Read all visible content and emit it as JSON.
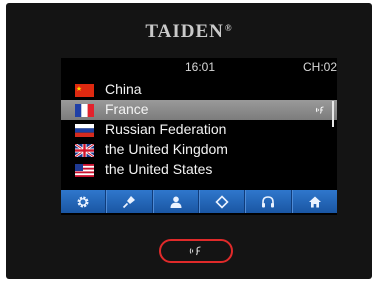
{
  "brand": {
    "name": "TAIDEN",
    "mark": "®"
  },
  "status": {
    "time": "16:01",
    "channel": "CH:02"
  },
  "languages": [
    {
      "label": "China",
      "flag": "china-flag-icon",
      "selected": false
    },
    {
      "label": "France",
      "flag": "france-flag-icon",
      "selected": true
    },
    {
      "label": "Russian Federation",
      "flag": "russia-flag-icon",
      "selected": false
    },
    {
      "label": "the United Kingdom",
      "flag": "uk-flag-icon",
      "selected": false
    },
    {
      "label": "the United States",
      "flag": "usa-flag-icon",
      "selected": false
    }
  ],
  "toolbar": {
    "buttons": [
      "gear-icon",
      "microphone-icon",
      "user-icon",
      "diamond-icon",
      "headphones-icon",
      "home-icon"
    ]
  },
  "colors": {
    "device": "#141414",
    "toolbar": "#1e63b6",
    "selection": "#8a8a8a",
    "accent_button": "#e02a2a"
  }
}
